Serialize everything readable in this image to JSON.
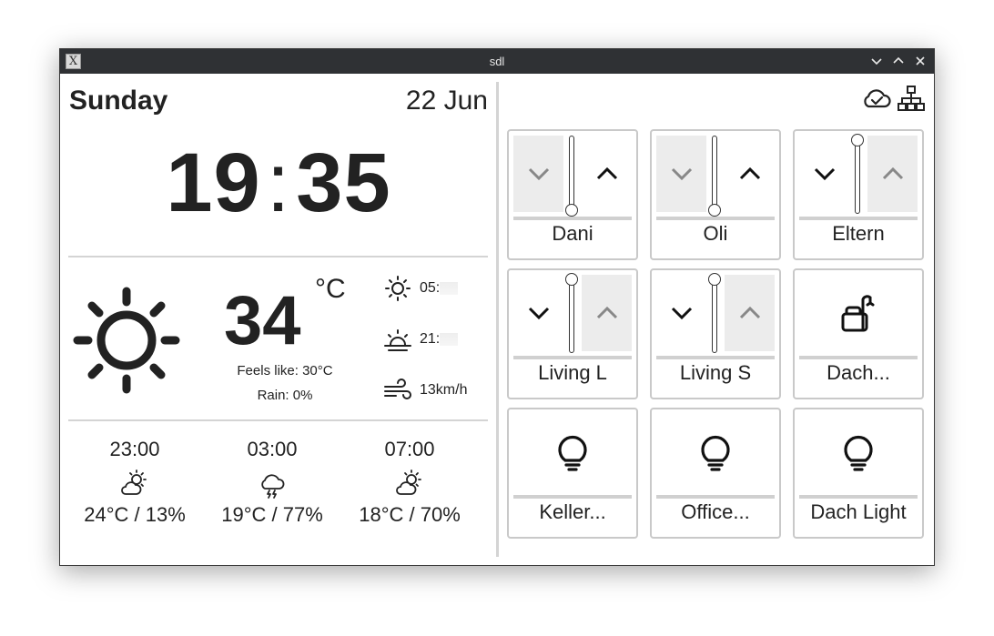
{
  "window": {
    "title": "sdl",
    "app_icon": "X"
  },
  "clock": {
    "day": "Sunday",
    "date": "22 Jun",
    "hours": "19",
    "colon": ":",
    "minutes": "35"
  },
  "weather": {
    "icon": "sun-icon",
    "temperature": "34",
    "unit": "°C",
    "feels_like": "Feels like: 30°C",
    "rain": "Rain: 0%",
    "sunrise": "05:",
    "sunset": "21:",
    "wind": "13km/h"
  },
  "forecast": [
    {
      "time": "23:00",
      "icon": "partly-cloudy-icon",
      "value": "24°C / 13%"
    },
    {
      "time": "03:00",
      "icon": "thunderstorm-icon",
      "value": "19°C / 77%"
    },
    {
      "time": "07:00",
      "icon": "partly-cloudy-icon",
      "value": "18°C / 70%"
    }
  ],
  "status_icons": [
    "cloud-check-icon",
    "network-icon"
  ],
  "tiles": [
    {
      "label": "Dani",
      "type": "shade",
      "position": 0
    },
    {
      "label": "Oli",
      "type": "shade",
      "position": 0
    },
    {
      "label": "Eltern",
      "type": "shade",
      "position": 1
    },
    {
      "label": "Living L",
      "type": "shade",
      "position": 1
    },
    {
      "label": "Living S",
      "type": "shade",
      "position": 1
    },
    {
      "label": "Dach...",
      "type": "scene",
      "icon": "bath-icon"
    },
    {
      "label": "Keller...",
      "type": "light",
      "icon": "bulb-icon"
    },
    {
      "label": "Office...",
      "type": "light",
      "icon": "bulb-icon"
    },
    {
      "label": "Dach Light",
      "type": "light",
      "icon": "bulb-icon"
    }
  ],
  "colors": {
    "text": "#222222",
    "tile_border": "#c9c9c9",
    "disabled_button": "#ececec",
    "titlebar": "#2f3134"
  }
}
